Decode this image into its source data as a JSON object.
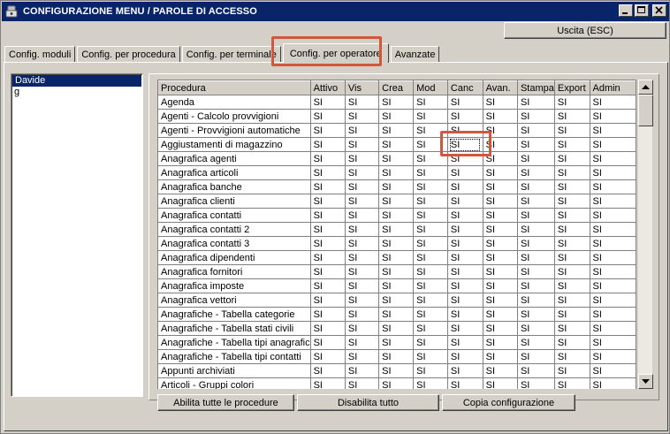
{
  "window": {
    "title": "CONFIGURAZIONE MENU / PAROLE DI ACCESSO",
    "icon": "app-icon",
    "controls": [
      "minimize",
      "maximize",
      "close"
    ]
  },
  "toolbar": {
    "exit_label": "Uscita (ESC)"
  },
  "tabs": [
    {
      "label": "Config. moduli",
      "active": false
    },
    {
      "label": "Config. per procedura",
      "active": false
    },
    {
      "label": "Config. per terminale",
      "active": false
    },
    {
      "label": "Config. per operatore",
      "active": true
    },
    {
      "label": "Avanzate",
      "active": false
    }
  ],
  "operators": [
    {
      "name": "Davide",
      "selected": true
    },
    {
      "name": "g",
      "selected": false
    }
  ],
  "grid": {
    "columns": [
      "Procedura",
      "Attivo",
      "Vis",
      "Crea",
      "Mod",
      "Canc",
      "Avan.",
      "Stampa",
      "Export",
      "Admin"
    ],
    "rows": [
      {
        "procedura": "Agenda",
        "values": [
          "SI",
          "SI",
          "SI",
          "SI",
          "SI",
          "SI",
          "SI",
          "SI",
          "SI"
        ]
      },
      {
        "procedura": "Agenti - Calcolo provvigioni",
        "values": [
          "SI",
          "SI",
          "SI",
          "SI",
          "SI",
          "SI",
          "SI",
          "SI",
          "SI"
        ]
      },
      {
        "procedura": "Agenti - Provvigioni automatiche",
        "values": [
          "SI",
          "SI",
          "SI",
          "SI",
          "SI",
          "SI",
          "SI",
          "SI",
          "SI"
        ]
      },
      {
        "procedura": "Aggiustamenti di magazzino",
        "values": [
          "SI",
          "SI",
          "SI",
          "SI",
          "SI",
          "SI",
          "SI",
          "SI",
          "SI"
        ]
      },
      {
        "procedura": "Anagrafica agenti",
        "values": [
          "SI",
          "SI",
          "SI",
          "SI",
          "SI",
          "SI",
          "SI",
          "SI",
          "SI"
        ]
      },
      {
        "procedura": "Anagrafica articoli",
        "values": [
          "SI",
          "SI",
          "SI",
          "SI",
          "SI",
          "SI",
          "SI",
          "SI",
          "SI"
        ]
      },
      {
        "procedura": "Anagrafica banche",
        "values": [
          "SI",
          "SI",
          "SI",
          "SI",
          "SI",
          "SI",
          "SI",
          "SI",
          "SI"
        ]
      },
      {
        "procedura": "Anagrafica clienti",
        "values": [
          "SI",
          "SI",
          "SI",
          "SI",
          "SI",
          "SI",
          "SI",
          "SI",
          "SI"
        ]
      },
      {
        "procedura": "Anagrafica contatti",
        "values": [
          "SI",
          "SI",
          "SI",
          "SI",
          "SI",
          "SI",
          "SI",
          "SI",
          "SI"
        ]
      },
      {
        "procedura": "Anagrafica contatti 2",
        "values": [
          "SI",
          "SI",
          "SI",
          "SI",
          "SI",
          "SI",
          "SI",
          "SI",
          "SI"
        ]
      },
      {
        "procedura": "Anagrafica contatti 3",
        "values": [
          "SI",
          "SI",
          "SI",
          "SI",
          "SI",
          "SI",
          "SI",
          "SI",
          "SI"
        ]
      },
      {
        "procedura": "Anagrafica dipendenti",
        "values": [
          "SI",
          "SI",
          "SI",
          "SI",
          "SI",
          "SI",
          "SI",
          "SI",
          "SI"
        ]
      },
      {
        "procedura": "Anagrafica fornitori",
        "values": [
          "SI",
          "SI",
          "SI",
          "SI",
          "SI",
          "SI",
          "SI",
          "SI",
          "SI"
        ]
      },
      {
        "procedura": "Anagrafica imposte",
        "values": [
          "SI",
          "SI",
          "SI",
          "SI",
          "SI",
          "SI",
          "SI",
          "SI",
          "SI"
        ]
      },
      {
        "procedura": "Anagrafica vettori",
        "values": [
          "SI",
          "SI",
          "SI",
          "SI",
          "SI",
          "SI",
          "SI",
          "SI",
          "SI"
        ]
      },
      {
        "procedura": "Anagrafiche - Tabella categorie",
        "values": [
          "SI",
          "SI",
          "SI",
          "SI",
          "SI",
          "SI",
          "SI",
          "SI",
          "SI"
        ]
      },
      {
        "procedura": "Anagrafiche - Tabella stati civili",
        "values": [
          "SI",
          "SI",
          "SI",
          "SI",
          "SI",
          "SI",
          "SI",
          "SI",
          "SI"
        ]
      },
      {
        "procedura": "Anagrafiche - Tabella tipi anagrafic",
        "values": [
          "SI",
          "SI",
          "SI",
          "SI",
          "SI",
          "SI",
          "SI",
          "SI",
          "SI"
        ]
      },
      {
        "procedura": "Anagrafiche - Tabella tipi contatti",
        "values": [
          "SI",
          "SI",
          "SI",
          "SI",
          "SI",
          "SI",
          "SI",
          "SI",
          "SI"
        ]
      },
      {
        "procedura": "Appunti archiviati",
        "values": [
          "SI",
          "SI",
          "SI",
          "SI",
          "SI",
          "SI",
          "SI",
          "SI",
          "SI"
        ]
      },
      {
        "procedura": "Articoli - Gruppi colori",
        "values": [
          "SI",
          "SI",
          "SI",
          "SI",
          "SI",
          "SI",
          "SI",
          "SI",
          "SI"
        ]
      }
    ],
    "focused_cell": {
      "row": 3,
      "col": 4
    }
  },
  "buttons": {
    "enable_all": "Abilita tutte le procedure",
    "disable_all": "Disabilita tutto",
    "copy_config": "Copia configurazione"
  },
  "colors": {
    "titlebar": "#0a246a",
    "face": "#d4d0c8",
    "selection": "#0a246a",
    "highlight": "#d1573d"
  }
}
